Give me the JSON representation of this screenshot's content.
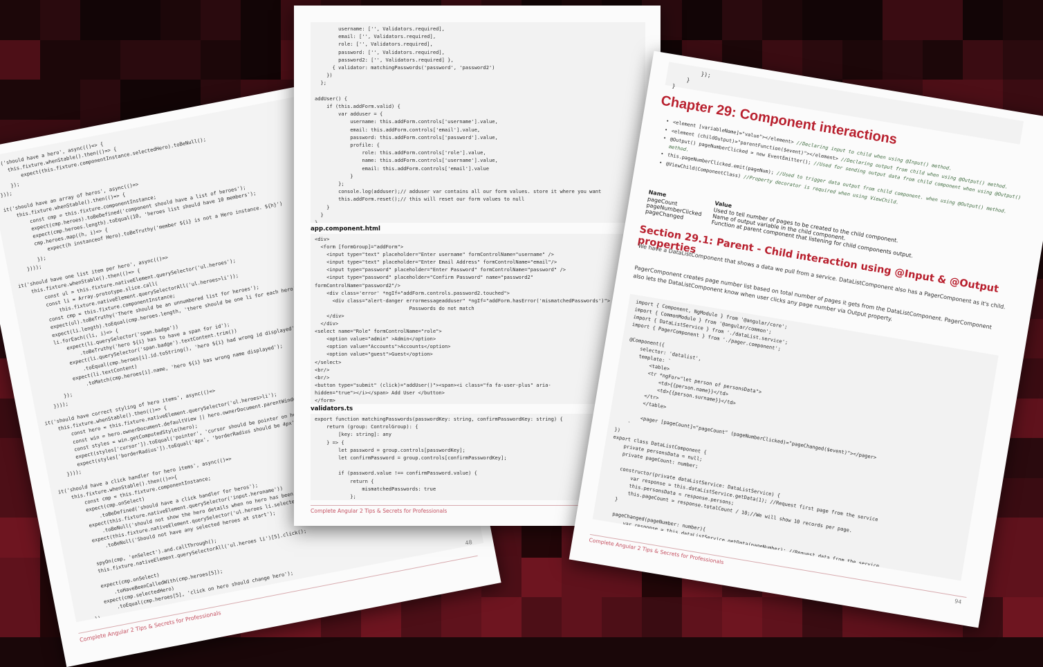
{
  "colors": {
    "background": "#1a0709",
    "accent": "#b81f2d",
    "footer": "#c45060"
  },
  "left_page": {
    "code": "it('should have a hero', async(()=> {\n    this.fixture.whenStable().then(()=> {\n        expect(this.fixture.componentInstance.selectedHero).toBeNull();\n    });\n}));\n\nit('should have an array of heros', async(()=>\n    this.fixture.whenStable().then(()=> {\n        const cmp = this.fixture.componentInstance;\n        expect(cmp.heroes).toBeDefined('component should have a list of heroes');\n        expect(cmp.heroes.length).toEqual(10, 'heroes list should have 10 members');\n        cmp.heroes.map((h, i)=> {\n            expect(h instanceof Hero).toBeTruthy('member ${i} is not a Hero instance. ${h}')\n        });\n    })));\n\nit('should have one list item per hero', async(()=>\n    this.fixture.whenStable().then(()=> {\n        const ul = this.fixture.nativeElement.querySelector('ul.heroes');\n        const li = Array.prototype.slice.call(\n            this.fixture.nativeElement.querySelectorAll('ul.heroes>li'));\n        const cmp = this.fixture.componentInstance;\n        expect(ul).toBeTruthy('There should be an unnumbered list for heroes');\n        expect(li.length).toEqual(cmp.heroes.length, 'there should be one li for each hero');\n        li.forEach((li, i)=> {\n            expect(li.querySelector('span.badge'))\n                .toBeTruthy('hero ${i} has to have a span for id');\n            expect(li.querySelector('span.badge').textContent.trim())\n                .toEqual(cmp.heroes[i].id.toString(), 'hero ${i} had wrong id displayed');\n            expect(li.textContent)\n                .toMatch(cmp.heroes[i].name, 'hero ${i} has wrong name displayed');\n        });\n    })));\n\nit('should have correct styling of hero items', async(()=>\n    this.fixture.whenStable().then(()=> {\n        const hero = this.fixture.nativeElement.querySelector('ul.heroes>li');\n        const win = hero.ownerDocument.defaultView || hero.ownerDocument.parentWindow;\n        const styles = win.getComputedStyle(hero);\n        expect(styles['cursor']).toEqual('pointer', 'cursor should be pointer on hero');\n        expect(styles['borderRadius']).toEqual('4px', 'borderRadius should be 4px');\n    })));\n\nit('should have a click handler for hero items', async(()=>\n    this.fixture.whenStable().then(()=>{\n        const cmp = this.fixture.componentInstance;\n        expect(cmp.onSelect)\n            .toBeDefined('should have a click handler for heros');\n        expect(this.fixture.nativeElement.querySelector('input.heroname'))\n            .toBeNull('should not show the hero details when no hero has been selected');\n        expect(this.fixture.nativeElement.querySelector('ul.heroes li.selected'))\n            .toBeNull('Should not have any selected heroes at start');\n\n        spyOn(cmp, 'onSelect').and.callThrough();\n        this.fixture.nativeElement.querySelectorAll('ul.heroes li')[5].click();\n\n        expect(cmp.onSelect)\n            .toHaveBeenCalledWith(cmp.heroes[5]);\n        expect(cmp.selectedHero)\n            .toEqual(cmp.heroes[5], 'click on hero should change hero');\n    })\n}));",
    "page_number": "48",
    "footer": "Complete Angular 2 Tips & Secrets for Professionals"
  },
  "center_page": {
    "code1": "        username: ['', Validators.required],\n        email: ['', Validators.required],\n        role: ['', Validators.required],\n        password: ['', Validators.required],\n        password2: ['', Validators.required] },\n      { validator: matchingPasswords('password', 'password2')\n    })\n  };\n\naddUser() {\n    if (this.addForm.valid) {\n        var adduser = {\n            username: this.addForm.controls['username'].value,\n            email: this.addForm.controls['email'].value,\n            password: this.addForm.controls['password'].value,\n            profile: {\n                role: this.addForm.controls['role'].value,\n                name: this.addForm.controls['username'].value,\n                email: this.addForm.controls['email'].value\n            }\n        };\n        console.log(adduser);// adduser var contains all our form values. store it where you want\n        this.addForm.reset();// this will reset our form values to null\n    }\n  }\n}",
    "title2": "app.component.html",
    "code2": "<div>\n  <form [formGroup]=\"addForm\">\n    <input type=\"text\" placeholder=\"Enter username\" formControlName=\"username\" />\n    <input type=\"text\" placeholder=\"Enter Email Address\" formControlName=\"email\"/>\n    <input type=\"password\" placeholder=\"Enter Password\" formControlName=\"password\" />\n    <input type=\"password\" placeholder=\"Confirm Password\" name=\"password2\"\nformControlName=\"password2\"/>\n    <div class='error' *ngIf=\"addForm.controls.password2.touched\">\n      <div class=\"alert-danger errormessageadduser\" *ngIf=\"addForm.hasError('mismatchedPasswords')\">\n                                Passwords do not match\n    </div>\n  </div>\n<select name=\"Role\" formControlName=\"role\">\n    <option value=\"admin\" >Admin</option>\n    <option value=\"Accounts\">Accounts</option>\n    <option value=\"guest\">Guest</option>\n</select>\n<br/>\n<br/>\n<button type=\"submit\" (click)=\"addUser()\"><span><i class=\"fa fa-user-plus\" aria-\nhidden=\"true\"></i></span> Add User </button>\n</form>\n</div>",
    "title3": "validators.ts",
    "code3": "export function matchingPasswords(passwordKey: string, confirmPasswordKey: string) {\n    return (group: ControlGroup): {\n        [key: string]: any\n    } => {\n        let password = group.controls[passwordKey];\n        let confirmPassword = group.controls[confirmPasswordKey];\n\n        if (password.value !== confirmPassword.value) {\n            return {\n                mismatchedPasswords: true\n            };",
    "footer": "Complete Angular 2 Tips & Secrets for Professionals"
  },
  "right_page": {
    "code_top": "        });\n    }\n}",
    "chapter_title": "Chapter 29: Component interactions",
    "bullets": [
      {
        "code": "<element [variableName]=\"value\"></element>",
        "comment": " //Declaring input to child when using @Input() method."
      },
      {
        "code": "<element (childOutput)=\"parentFunction($event)\"></element>",
        "comment": " //Declaring output from child when using @Output() method."
      },
      {
        "code": "@Output() pageNumberClicked = new EventEmitter();",
        "comment": " //Used for sending output data from child component when using @Output() method."
      },
      {
        "code": "this.pageNumberClicked.emit(pageNum);",
        "comment": " //Used to trigger data output from child component. when using @Output() method."
      },
      {
        "code": "@ViewChild(ComponentClass)",
        "comment": " //Property decorator is required when using ViewChild."
      }
    ],
    "table": {
      "headers": [
        "Name",
        "Value"
      ],
      "rows": [
        [
          "pageCount",
          "Used to tell number of pages to be created to the child component."
        ],
        [
          "pageNumberClicked",
          "Name of output variable in the child component."
        ],
        [
          "pageChanged",
          "Function at parent component that listening for child components output."
        ]
      ]
    },
    "section_title": "Section 29.1: Parent - Child interaction using @Input & @Output properties",
    "para1": "We have a DataListComponent that shows a data we pull from a service. DataListComponent also has a PagerComponent as it's child.",
    "para2": "PagerComponent creates page number list based on total number of pages it gets from the DataListComponent. PagerComponent also lets the DataListComponent know when user clicks any page number via Output property.",
    "code": "import { Component, NgModule } from '@angular/core';\nimport { CommonModule } from '@angular/common';\nimport { DataListService } from './dataList.service';\nimport { PagerComponent } from './pager.component';\n\n@Component({\n    selector: 'datalist',\n    template: `\n        <table>\n        <tr *ngFor=\"let person of personsData\">\n            <td>{{person.name}}</td>\n            <td>{{person.surname}}</td>\n        </tr>\n        </table>\n\n        <pager [pageCount]=\"pageCount\" (pageNumberClicked)=\"pageChanged($event)\"></pager>\n    `\n})\nexport class DataListComponent {\n    private personsData = null;\n    private pageCount: number;\n\n    constructor(private dataListService: DataListService) {\n        var response = this.dataListService.getData(1); //Request first page from the service\n        this.personsData = response.persons;\n        this.pageCount = response.totalCount / 10;//We will show 10 records per page.\n    }\n\n    pageChanged(pageNumber: number){\n        var response = this.dataListService.getData(pageNumber); //Request data from the service\nwith new page number",
    "footer": "Complete Angular 2 Tips & Secrets for Professionals",
    "page_number": "94"
  }
}
